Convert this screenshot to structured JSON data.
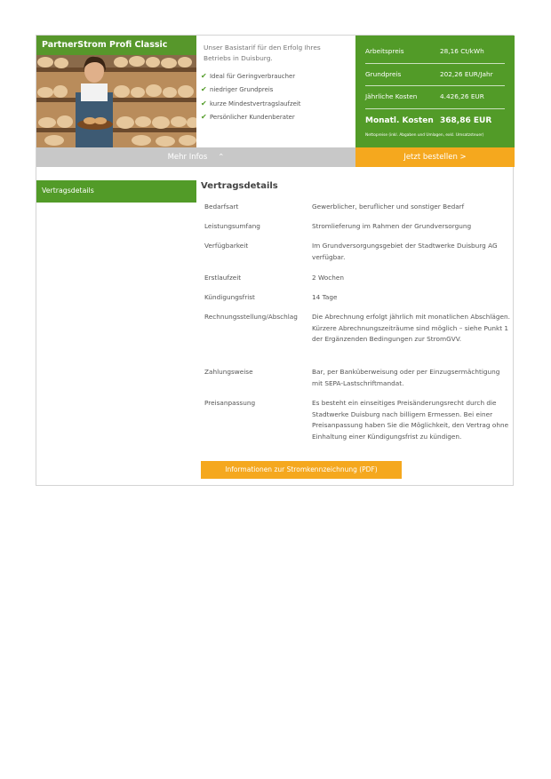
{
  "product": {
    "title": "PartnerStrom Profi Classic",
    "intro": "Unser Basistarif für den Erfolg Ihres Betriebs in Duisburg.",
    "features": [
      "Ideal für Geringverbraucher",
      "niedriger Grundpreis",
      "kurze Mindestvertragslaufzeit",
      "Persönlicher Kundenberater"
    ]
  },
  "prices": {
    "rows": [
      {
        "label": "Arbeitspreis",
        "value": "28,16 Ct/kWh"
      },
      {
        "label": "Grundpreis",
        "value": "202,26 EUR/Jahr"
      },
      {
        "label": "Jährliche Kosten",
        "value": "4.426,26 EUR"
      }
    ],
    "total": {
      "label": "Monatl. Kosten",
      "value": "368,86 EUR"
    },
    "note": "Nettopreise (inkl. Abgaben und Umlagen, exkl. Umsatzsteuer)"
  },
  "buttons": {
    "more_info": "Mehr Infos",
    "order": "Jetzt bestellen >",
    "pdf": "Informationen zur Stromkennzeichnung (PDF)"
  },
  "sidebar": {
    "tab": "Vertragsdetails"
  },
  "details": {
    "title": "Vertragsdetails",
    "rows": [
      {
        "label": "Bedarfsart",
        "value": "Gewerblicher, beruflicher und sonstiger Bedarf"
      },
      {
        "label": "Leistungsumfang",
        "value": "Stromlieferung im Rahmen der Grundversorgung"
      },
      {
        "label": "Verfügbarkeit",
        "value": "Im Grundversorgungsgebiet der Stadtwerke Duisburg AG verfügbar."
      },
      {
        "label": "Erstlaufzeit",
        "value": "2 Wochen"
      },
      {
        "label": "Kündigungsfrist",
        "value": "14 Tage"
      },
      {
        "label": "Rechnungsstellung/Abschlag",
        "value": "Die Abrechnung erfolgt jährlich mit monatlichen Abschlägen. Kürzere Abrechnungszeiträume sind möglich – siehe Punkt 1 der Ergänzenden Bedingungen zur StromGVV."
      },
      {
        "label": "Zahlungsweise",
        "value": "Bar, per Banküberweisung oder per Einzugsermächtigung mit SEPA-Lastschriftmandat."
      },
      {
        "label": "Preisanpassung",
        "value": "Es besteht ein einseitiges Preisänderungsrecht durch die Stadtwerke Duisburg nach billigem Ermessen. Bei einer Preisanpassung haben Sie die Möglichkeit, den Vertrag ohne Einhaltung einer Kündigungsfrist zu kündigen."
      }
    ]
  },
  "colors": {
    "green": "#529b28",
    "orange": "#f5a81e",
    "grey": "#c8c8c8"
  }
}
